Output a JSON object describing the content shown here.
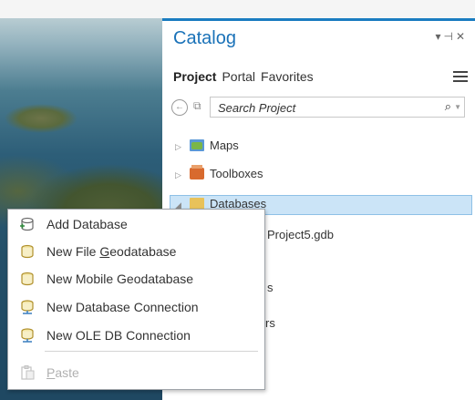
{
  "catalog": {
    "title": "Catalog",
    "tabs": [
      "Project",
      "Portal",
      "Favorites"
    ],
    "search": {
      "placeholder": "Search Project"
    },
    "tree": {
      "maps": "Maps",
      "toolboxes": "Toolboxes",
      "databases": "Databases",
      "gdb_partial": "Project5.gdb",
      "partial_s": "s",
      "partial_rs": "rs"
    }
  },
  "context_menu": {
    "items": [
      {
        "label": "Add Database",
        "icon": "add-database-icon"
      },
      {
        "label_pre": "New File ",
        "label_u": "G",
        "label_post": "eodatabase",
        "icon": "new-file-geodatabase-icon"
      },
      {
        "label": "New Mobile Geodatabase",
        "icon": "new-mobile-geodatabase-icon"
      },
      {
        "label": "New Database Connection",
        "icon": "new-database-connection-icon"
      },
      {
        "label": "New OLE DB Connection",
        "icon": "new-ole-db-connection-icon"
      },
      {
        "label_u": "P",
        "label_post": "aste",
        "icon": "paste-icon",
        "disabled": true
      }
    ]
  },
  "colors": {
    "accent": "#1a7cc0",
    "selection": "#cbe4f7",
    "title": "#1a72b8"
  }
}
